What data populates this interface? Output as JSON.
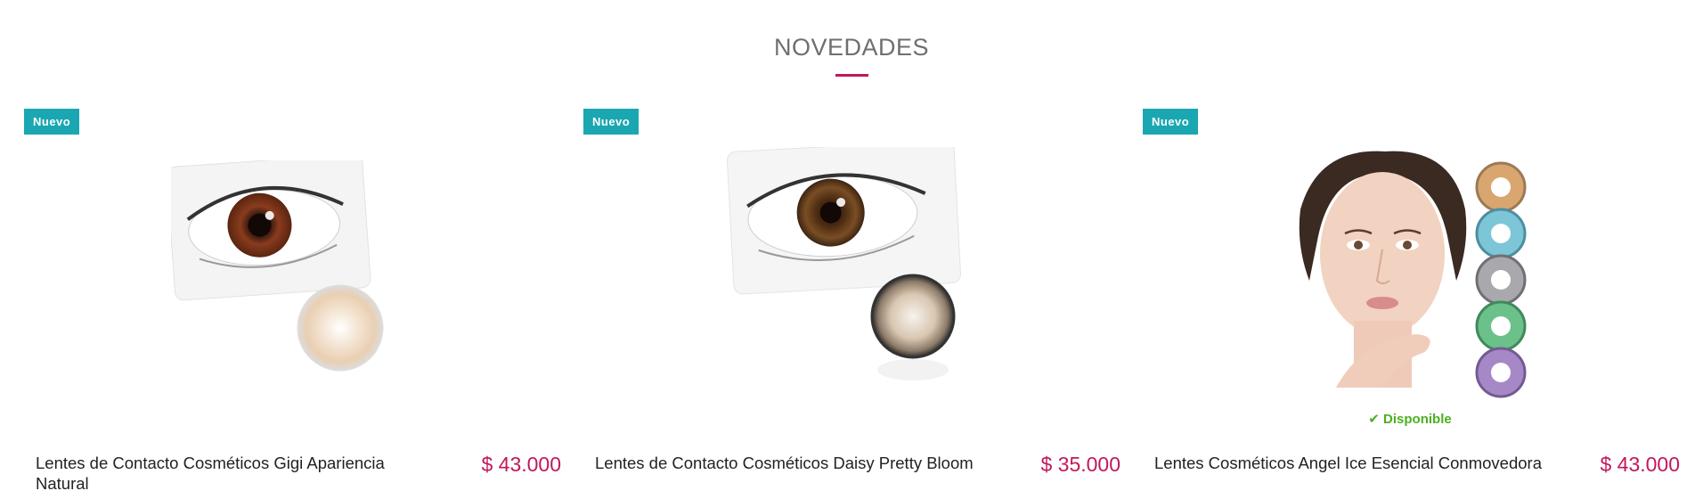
{
  "section": {
    "title": "NOVEDADES"
  },
  "products": [
    {
      "badge": "Nuevo",
      "name": "Lentes de Contacto Cosméticos Gigi Apariencia Natural",
      "price": "$ 43.000",
      "stock": ""
    },
    {
      "badge": "Nuevo",
      "name": "Lentes de Contacto Cosméticos Daisy Pretty Bloom",
      "price": "$ 35.000",
      "stock": ""
    },
    {
      "badge": "Nuevo",
      "name": "Lentes Cosméticos Angel Ice Esencial Conmovedora",
      "price": "$ 43.000",
      "stock": "Disponible"
    }
  ],
  "colors": {
    "accent": "#c2185b",
    "badge": "#1aa7b2",
    "available": "#4caf20"
  },
  "icons": {
    "stock": "check-icon"
  }
}
